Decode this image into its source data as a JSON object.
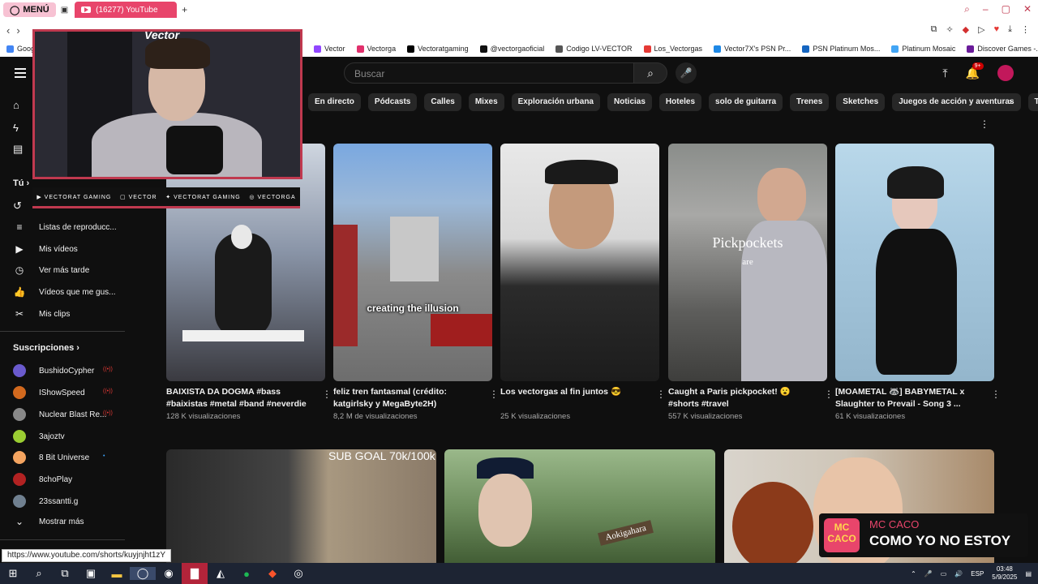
{
  "browser": {
    "menu_label": "MENÚ",
    "tab_title": "(16277) YouTube",
    "bookmarks": [
      "Vector",
      "Vectorga",
      "Vectoratgaming",
      "@vectorgaoficial",
      "Codigo LV-VECTOR",
      "Los_Vectorgas",
      "Vector7X's PSN Pr...",
      "PSN Platinum Mos...",
      "Platinum Mosaic",
      "Discover Games -..."
    ],
    "bookmark_first": "Goog",
    "status_url": "https://www.youtube.com/shorts/kuyjnjht1zY"
  },
  "header": {
    "search_placeholder": "Buscar",
    "notif_badge": "9+"
  },
  "chips": [
    "En directo",
    "Pódcasts",
    "Calles",
    "Mixes",
    "Exploración urbana",
    "Noticias",
    "Hoteles",
    "solo de guitarra",
    "Trenes",
    "Sketches",
    "Juegos de acción y aventuras",
    "Turismo"
  ],
  "sidebar": {
    "you_label": "Tú",
    "items": [
      "Listas de reproducc...",
      "Mis vídeos",
      "Ver más tarde",
      "Vídeos que me gus...",
      "Mis clips"
    ],
    "subs_label": "Suscripciones",
    "subs": [
      "BushidoCypher",
      "IShowSpeed",
      "Nuclear Blast Re...",
      "3ajoztv",
      "8 Bit Universe",
      "8choPlay",
      "23ssantti.g"
    ],
    "show_more": "Mostrar más"
  },
  "shorts": [
    {
      "title": "BAIXISTA DA DOGMA  #bass #baixistas #metal #band #neverdie",
      "views": "128 K visualizaciones"
    },
    {
      "title": "feliz tren fantasmal (crédito: katgirlsky y MegaByte2H)",
      "views": "8,2 M de visualizaciones",
      "caption": "creating the illusion"
    },
    {
      "title": "Los vectorgas al fin juntos 😎",
      "views": "25 K visualizaciones"
    },
    {
      "title": "Caught a Paris pickpocket! 😮 #shorts #travel",
      "views": "557 K visualizaciones",
      "caption": "Pickpockets",
      "caption2": "are"
    },
    {
      "title": "[MOAMETAL 🦝] BABYMETAL x Slaughter to Prevail - Song 3 ...",
      "views": "61 K visualizaciones"
    }
  ],
  "row2": {
    "goal_text": "SUB GOAL 70k/100k",
    "sign_text": "Aokigahara"
  },
  "overlay": {
    "cam_logo": "Vector",
    "socials": [
      "VECTORAT GAMING",
      "VECTOR",
      "VECTORAT GAMING",
      "VECTORGA"
    ],
    "song_badge": "MC CACO",
    "song_artist": "MC CACO",
    "song_title": "COMO YO NO ESTOY"
  },
  "taskbar": {
    "lang": "ESP",
    "time": "03:48",
    "date": "5/9/2025"
  }
}
